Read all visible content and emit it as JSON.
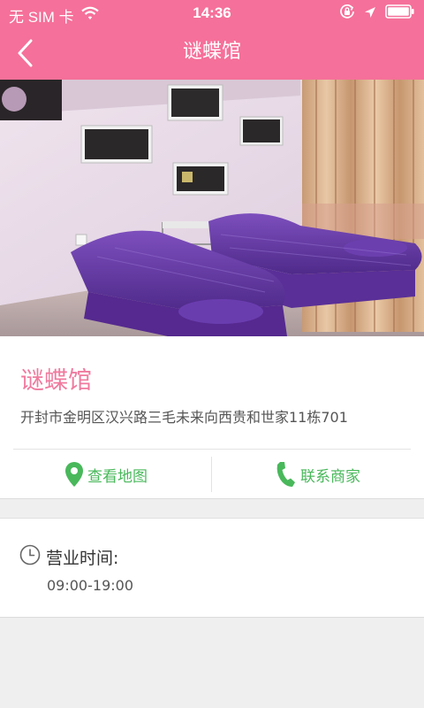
{
  "status_bar": {
    "carrier": "无 SIM 卡",
    "time": "14:36",
    "icons": [
      "wifi-icon",
      "orientation-lock-icon",
      "location-arrow-icon",
      "battery-icon"
    ]
  },
  "nav": {
    "title": "谜蝶馆",
    "back_icon": "chevron-left-icon"
  },
  "hero": {
    "alt": "beauty salon treatment room with purple massage beds"
  },
  "shop": {
    "name": "谜蝶馆",
    "address": "开封市金明区汉兴路三毛未来向西贵和世家11栋701"
  },
  "actions": {
    "map_label": "查看地图",
    "map_icon": "map-pin-icon",
    "contact_label": "联系商家",
    "contact_icon": "phone-icon"
  },
  "hours": {
    "title": "营业时间:",
    "value": "09:00-19:00",
    "icon": "clock-icon"
  },
  "colors": {
    "brand": "#f5709a",
    "accent_green": "#49b85b",
    "shop_name": "#f07a9f"
  }
}
